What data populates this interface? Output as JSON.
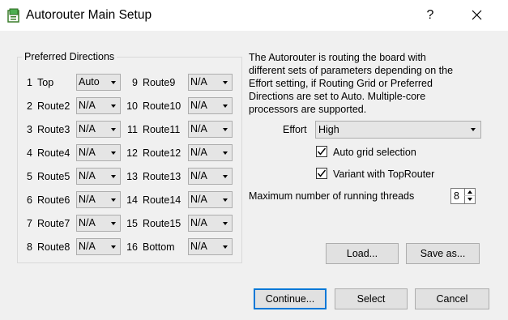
{
  "window": {
    "title": "Autorouter Main Setup",
    "help_label": "?"
  },
  "directions": {
    "group_label": "Preferred Directions",
    "left": [
      {
        "num": "1",
        "name": "Top",
        "value": "Auto"
      },
      {
        "num": "2",
        "name": "Route2",
        "value": "N/A"
      },
      {
        "num": "3",
        "name": "Route3",
        "value": "N/A"
      },
      {
        "num": "4",
        "name": "Route4",
        "value": "N/A"
      },
      {
        "num": "5",
        "name": "Route5",
        "value": "N/A"
      },
      {
        "num": "6",
        "name": "Route6",
        "value": "N/A"
      },
      {
        "num": "7",
        "name": "Route7",
        "value": "N/A"
      },
      {
        "num": "8",
        "name": "Route8",
        "value": "N/A"
      }
    ],
    "right": [
      {
        "num": "9",
        "name": "Route9",
        "value": "N/A"
      },
      {
        "num": "10",
        "name": "Route10",
        "value": "N/A"
      },
      {
        "num": "11",
        "name": "Route11",
        "value": "N/A"
      },
      {
        "num": "12",
        "name": "Route12",
        "value": "N/A"
      },
      {
        "num": "13",
        "name": "Route13",
        "value": "N/A"
      },
      {
        "num": "14",
        "name": "Route14",
        "value": "N/A"
      },
      {
        "num": "15",
        "name": "Route15",
        "value": "N/A"
      },
      {
        "num": "16",
        "name": "Bottom",
        "value": "N/A"
      }
    ]
  },
  "description": {
    "lines": [
      "The Autorouter is routing the board with",
      "different sets of parameters depending on the",
      "Effort setting, if Routing Grid or Preferred",
      "Directions are set to Auto. Multiple-core",
      "processors are supported."
    ]
  },
  "effort": {
    "label": "Effort",
    "value": "High"
  },
  "options": {
    "auto_grid": {
      "label": "Auto grid selection",
      "checked": true
    },
    "top_router": {
      "label": "Variant with TopRouter",
      "checked": true
    }
  },
  "threads": {
    "label": "Maximum number of running threads",
    "value": "8"
  },
  "buttons": {
    "load": "Load...",
    "save_as": "Save as...",
    "continue": "Continue...",
    "select": "Select",
    "cancel": "Cancel"
  }
}
